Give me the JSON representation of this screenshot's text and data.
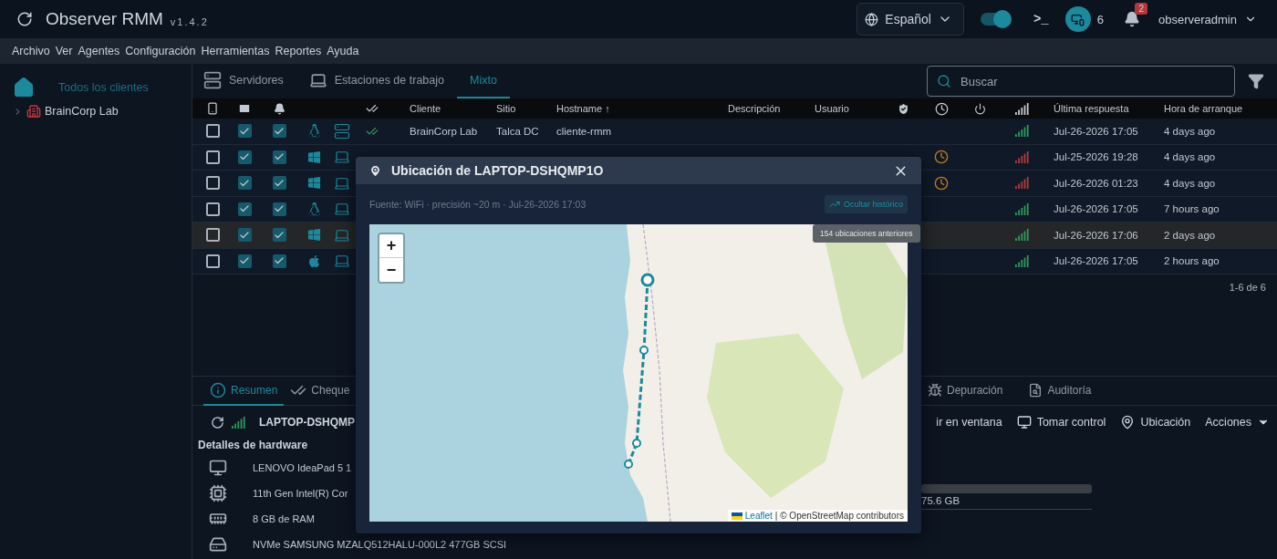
{
  "app": {
    "title": "Observer RMM",
    "version": "v1.4.2"
  },
  "header": {
    "language": "Español",
    "toggle_on": true,
    "terminal": ">_",
    "devices_count": "6",
    "notifications": "2",
    "user": "observeradmin"
  },
  "menu": [
    "Archivo",
    "Ver",
    "Agentes",
    "Configuración",
    "Herramientas",
    "Reportes",
    "Ayuda"
  ],
  "sidebar": {
    "all_clients": {
      "label": "Todos los clientes",
      "selected": true
    },
    "tree": [
      {
        "label": "BrainCorp Lab",
        "expanded": false,
        "selected": false
      }
    ]
  },
  "view_tabs": [
    {
      "label": "Servidores",
      "selected": false,
      "kind": "server"
    },
    {
      "label": "Estaciones de trabajo",
      "selected": false,
      "kind": "workstation"
    },
    {
      "label": "Mixto",
      "selected": true,
      "kind": "mixed"
    }
  ],
  "search": {
    "placeholder": "Buscar"
  },
  "table": {
    "columns": [
      {
        "label": "Cliente"
      },
      {
        "label": "Sitio"
      },
      {
        "label": "Hostname",
        "sort_arrow": "↑"
      },
      {
        "label": "Descripción"
      },
      {
        "label": "Usuario"
      },
      {
        "label": "Última respuesta"
      },
      {
        "label": "Hora de arranque"
      }
    ],
    "rows": [
      {
        "selected": false,
        "checked": false,
        "mail_alert": true,
        "bell_alert": true,
        "os": {
          "kind": "linux"
        },
        "device": {
          "kind": "server"
        },
        "checks_passing": true,
        "client": "BrainCorp Lab",
        "site": "Talca DC",
        "hostname": "cliente-rmm",
        "overdue": false,
        "signal": {
          "kind": "good"
        },
        "last_response": "Jul-26-2026 17:05",
        "boot_time": "4 days ago"
      },
      {
        "selected": false,
        "checked": false,
        "mail_alert": true,
        "bell_alert": true,
        "os": {
          "kind": "windows"
        },
        "device": {
          "kind": "laptop"
        },
        "overdue": true,
        "signal": {
          "kind": "bad"
        },
        "last_response": "Jul-25-2026 19:28",
        "boot_time": "4 days ago"
      },
      {
        "selected": false,
        "checked": false,
        "mail_alert": true,
        "bell_alert": true,
        "os": {
          "kind": "windows"
        },
        "device": {
          "kind": "laptop"
        },
        "overdue": true,
        "signal": {
          "kind": "bad"
        },
        "last_response": "Jul-26-2026 01:23",
        "boot_time": "4 days ago"
      },
      {
        "selected": false,
        "checked": false,
        "mail_alert": true,
        "bell_alert": true,
        "os": {
          "kind": "linux"
        },
        "device": {
          "kind": "laptop"
        },
        "overdue": false,
        "signal": {
          "kind": "good"
        },
        "last_response": "Jul-26-2026 17:05",
        "boot_time": "7 hours ago"
      },
      {
        "selected": true,
        "checked": false,
        "mail_alert": true,
        "bell_alert": true,
        "os": {
          "kind": "windows"
        },
        "device": {
          "kind": "laptop"
        },
        "overdue": false,
        "signal": {
          "kind": "good"
        },
        "last_response": "Jul-26-2026 17:06",
        "boot_time": "2 days ago"
      },
      {
        "selected": false,
        "checked": false,
        "mail_alert": true,
        "bell_alert": true,
        "os": {
          "kind": "apple"
        },
        "device": {
          "kind": "laptop"
        },
        "overdue": false,
        "signal": {
          "kind": "good"
        },
        "last_response": "Jul-26-2026 17:05",
        "boot_time": "2 hours ago"
      }
    ],
    "pagination": "1-6 de 6"
  },
  "detail_tabs": [
    {
      "label": "Resumen",
      "selected": true,
      "kind": "summary"
    },
    {
      "label": "Cheque",
      "selected": false,
      "kind": "checks"
    },
    {
      "label": "Depuración",
      "selected": false,
      "kind": "debug"
    },
    {
      "label": "Auditoría",
      "selected": false,
      "kind": "audit"
    }
  ],
  "agent_bar": {
    "hostname": "LAPTOP-DSHQMP",
    "signal": {
      "kind": "good"
    },
    "actions": [
      {
        "label": "ir en ventana",
        "kind": "window"
      },
      {
        "label": "Tomar control",
        "kind": "remote"
      },
      {
        "label": "Ubicación",
        "kind": "location"
      },
      {
        "label": "Acciones",
        "kind": "menu"
      }
    ]
  },
  "hardware": {
    "title": "Detalles de hardware",
    "items": [
      {
        "kind": "model",
        "text": "LENOVO IdeaPad 5 1"
      },
      {
        "kind": "cpu",
        "text": "11th Gen Intel(R) Cor"
      },
      {
        "kind": "ram",
        "text": "8 GB de RAM"
      },
      {
        "kind": "disk",
        "text": "NVMe SAMSUNG MZALQ512HALU-000L2 477GB SCSI"
      }
    ],
    "disk_usage": "75.6 GB"
  },
  "dialog": {
    "title": "Ubicación de LAPTOP-DSHQMP1O",
    "source": "Fuente: WiFi · precisión ~20 m · Jul-26-2026 17:03",
    "history_button": "Ocultar histórico",
    "tooltip": "154 ubicaciones anteriores",
    "zoom_in": "+",
    "zoom_out": "−",
    "attribution_link": "Leaflet",
    "attribution_text": "| © OpenStreetMap contributors"
  }
}
